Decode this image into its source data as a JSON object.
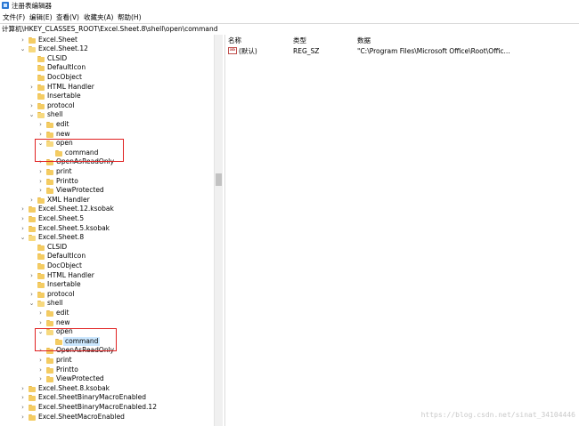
{
  "window": {
    "title": "注册表编辑器"
  },
  "menu": [
    "文件(F)",
    "编辑(E)",
    "查看(V)",
    "收藏夹(A)",
    "帮助(H)"
  ],
  "address": "计算机\\HKEY_CLASSES_ROOT\\Excel.Sheet.8\\shell\\open\\command",
  "tree": [
    {
      "label": "Excel.Sheet",
      "depth": 2,
      "expander": "collapsed"
    },
    {
      "label": "Excel.Sheet.12",
      "depth": 2,
      "expander": "expanded"
    },
    {
      "label": "CLSID",
      "depth": 3,
      "expander": "none"
    },
    {
      "label": "DefaultIcon",
      "depth": 3,
      "expander": "none"
    },
    {
      "label": "DocObject",
      "depth": 3,
      "expander": "none"
    },
    {
      "label": "HTML Handler",
      "depth": 3,
      "expander": "collapsed"
    },
    {
      "label": "Insertable",
      "depth": 3,
      "expander": "none"
    },
    {
      "label": "protocol",
      "depth": 3,
      "expander": "collapsed"
    },
    {
      "label": "shell",
      "depth": 3,
      "expander": "expanded"
    },
    {
      "label": "edit",
      "depth": 4,
      "expander": "collapsed"
    },
    {
      "label": "new",
      "depth": 4,
      "expander": "collapsed"
    },
    {
      "label": "open",
      "depth": 4,
      "expander": "expanded"
    },
    {
      "label": "command",
      "depth": 5,
      "expander": "none"
    },
    {
      "label": "OpenAsReadOnly",
      "depth": 4,
      "expander": "collapsed"
    },
    {
      "label": "print",
      "depth": 4,
      "expander": "collapsed"
    },
    {
      "label": "Printto",
      "depth": 4,
      "expander": "collapsed"
    },
    {
      "label": "ViewProtected",
      "depth": 4,
      "expander": "collapsed"
    },
    {
      "label": "XML Handler",
      "depth": 3,
      "expander": "collapsed"
    },
    {
      "label": "Excel.Sheet.12.ksobak",
      "depth": 2,
      "expander": "collapsed"
    },
    {
      "label": "Excel.Sheet.5",
      "depth": 2,
      "expander": "collapsed"
    },
    {
      "label": "Excel.Sheet.5.ksobak",
      "depth": 2,
      "expander": "collapsed"
    },
    {
      "label": "Excel.Sheet.8",
      "depth": 2,
      "expander": "expanded"
    },
    {
      "label": "CLSID",
      "depth": 3,
      "expander": "none"
    },
    {
      "label": "DefaultIcon",
      "depth": 3,
      "expander": "none"
    },
    {
      "label": "DocObject",
      "depth": 3,
      "expander": "none"
    },
    {
      "label": "HTML Handler",
      "depth": 3,
      "expander": "collapsed"
    },
    {
      "label": "Insertable",
      "depth": 3,
      "expander": "none"
    },
    {
      "label": "protocol",
      "depth": 3,
      "expander": "collapsed"
    },
    {
      "label": "shell",
      "depth": 3,
      "expander": "expanded"
    },
    {
      "label": "edit",
      "depth": 4,
      "expander": "collapsed"
    },
    {
      "label": "new",
      "depth": 4,
      "expander": "collapsed"
    },
    {
      "label": "open",
      "depth": 4,
      "expander": "expanded"
    },
    {
      "label": "command",
      "depth": 5,
      "expander": "none",
      "selected": true
    },
    {
      "label": "OpenAsReadOnly",
      "depth": 4,
      "expander": "collapsed"
    },
    {
      "label": "print",
      "depth": 4,
      "expander": "collapsed"
    },
    {
      "label": "Printto",
      "depth": 4,
      "expander": "collapsed"
    },
    {
      "label": "ViewProtected",
      "depth": 4,
      "expander": "collapsed"
    },
    {
      "label": "Excel.Sheet.8.ksobak",
      "depth": 2,
      "expander": "collapsed"
    },
    {
      "label": "Excel.SheetBinaryMacroEnabled",
      "depth": 2,
      "expander": "collapsed"
    },
    {
      "label": "Excel.SheetBinaryMacroEnabled.12",
      "depth": 2,
      "expander": "collapsed"
    },
    {
      "label": "Excel.SheetMacroEnabled",
      "depth": 2,
      "expander": "collapsed"
    }
  ],
  "values": {
    "headers": {
      "name": "名称",
      "type": "类型",
      "data": "数据"
    },
    "rows": [
      {
        "icon": "string-value-icon",
        "icon_text": "ab",
        "name": "(默认)",
        "type": "REG_SZ",
        "data": "\"C:\\Program Files\\Microsoft Office\\Root\\Offic..."
      }
    ]
  },
  "watermark": "https://blog.csdn.net/sinat_34104446",
  "colors": {
    "folder": "#f4cc63",
    "selection": "#cce8ff",
    "highlight_box": "#e02020",
    "app_icon": "#2b78d4"
  }
}
